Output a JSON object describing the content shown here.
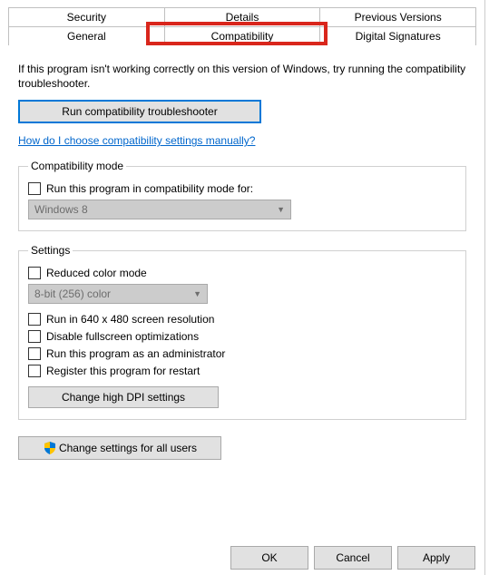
{
  "tabs": {
    "row1": [
      {
        "key": "security",
        "label": "Security"
      },
      {
        "key": "details",
        "label": "Details"
      },
      {
        "key": "previous",
        "label": "Previous Versions"
      }
    ],
    "row2": [
      {
        "key": "general",
        "label": "General"
      },
      {
        "key": "compatibility",
        "label": "Compatibility"
      },
      {
        "key": "signatures",
        "label": "Digital Signatures"
      }
    ],
    "active": "compatibility"
  },
  "intro": "If this program isn't working correctly on this version of Windows, try running the compatibility troubleshooter.",
  "troubleshooter_btn": "Run compatibility troubleshooter",
  "manual_link": "How do I choose compatibility settings manually?",
  "compat_mode": {
    "legend": "Compatibility mode",
    "check_label": "Run this program in compatibility mode for:",
    "selected": "Windows 8"
  },
  "settings": {
    "legend": "Settings",
    "reduced_color": "Reduced color mode",
    "color_selected": "8-bit (256) color",
    "run_640": "Run in 640 x 480 screen resolution",
    "disable_fullscreen": "Disable fullscreen optimizations",
    "run_admin": "Run this program as an administrator",
    "register_restart": "Register this program for restart",
    "dpi_btn": "Change high DPI settings"
  },
  "all_users_btn": "Change settings for all users",
  "buttons": {
    "ok": "OK",
    "cancel": "Cancel",
    "apply": "Apply"
  }
}
